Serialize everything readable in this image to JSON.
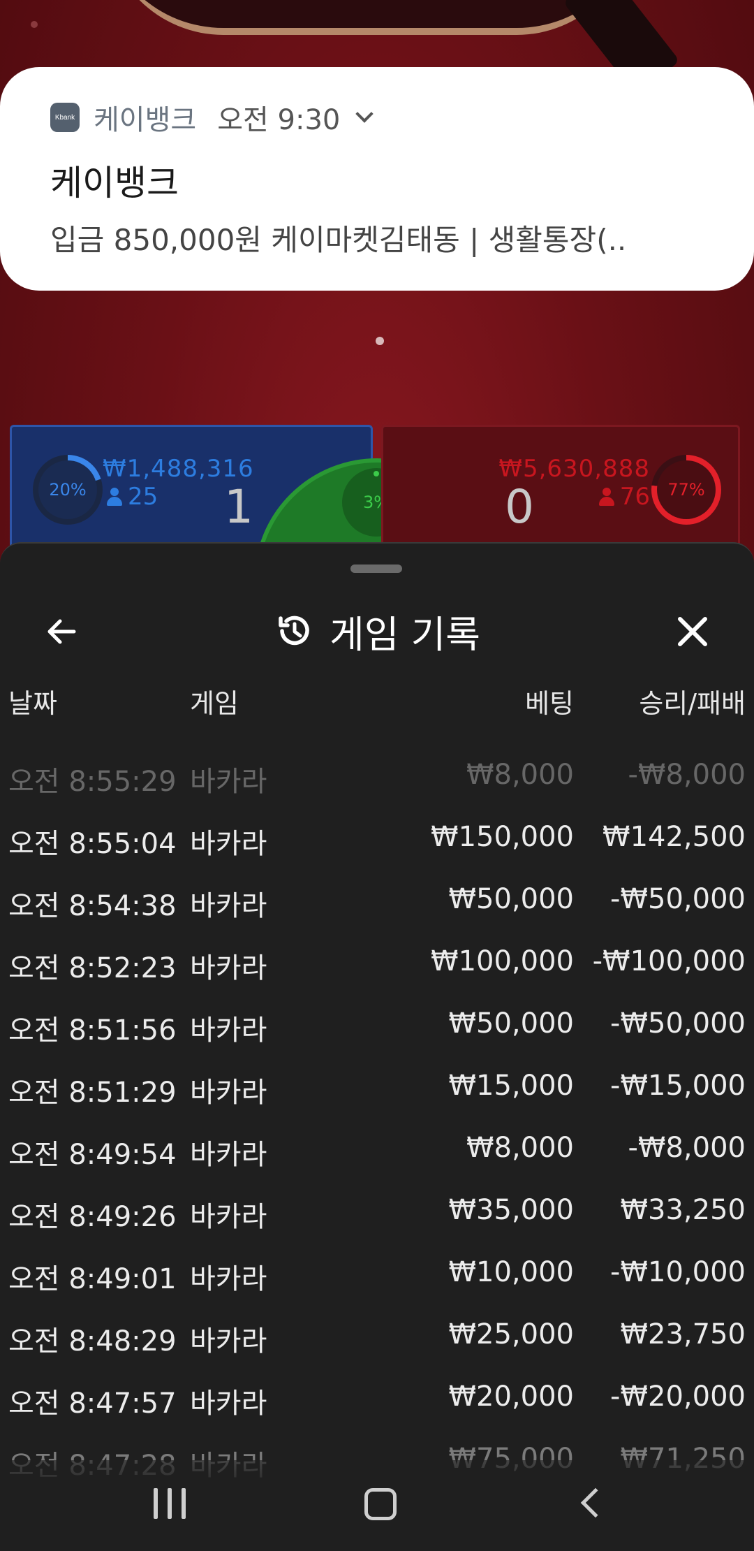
{
  "notification": {
    "app_icon_text": "Kbank",
    "app_name": "케이뱅크",
    "time": "오전 9:30",
    "title": "케이뱅크",
    "body": "입금 850,000원 케이마켓김태동 | 생활통장(.."
  },
  "game": {
    "player": {
      "percent": "20%",
      "percent_value": 0.2,
      "amount": "₩1,488,316",
      "count": "25",
      "score": "1"
    },
    "tie": {
      "percent": "3%"
    },
    "banker": {
      "percent": "77%",
      "percent_value": 0.77,
      "amount": "₩5,630,888",
      "count": "76",
      "score": "0"
    }
  },
  "sheet": {
    "title": "게임 기록",
    "columns": {
      "date": "날짜",
      "game": "게임",
      "bet": "베팅",
      "win_loss": "승리/패배"
    },
    "rows": [
      {
        "date": "오전 8:55:29",
        "game": "바카라",
        "bet": "₩8,000",
        "result": "-₩8,000"
      },
      {
        "date": "오전 8:55:04",
        "game": "바카라",
        "bet": "₩150,000",
        "result": "₩142,500"
      },
      {
        "date": "오전 8:54:38",
        "game": "바카라",
        "bet": "₩50,000",
        "result": "-₩50,000"
      },
      {
        "date": "오전 8:52:23",
        "game": "바카라",
        "bet": "₩100,000",
        "result": "-₩100,000"
      },
      {
        "date": "오전 8:51:56",
        "game": "바카라",
        "bet": "₩50,000",
        "result": "-₩50,000"
      },
      {
        "date": "오전 8:51:29",
        "game": "바카라",
        "bet": "₩15,000",
        "result": "-₩15,000"
      },
      {
        "date": "오전 8:49:54",
        "game": "바카라",
        "bet": "₩8,000",
        "result": "-₩8,000"
      },
      {
        "date": "오전 8:49:26",
        "game": "바카라",
        "bet": "₩35,000",
        "result": "₩33,250"
      },
      {
        "date": "오전 8:49:01",
        "game": "바카라",
        "bet": "₩10,000",
        "result": "-₩10,000"
      },
      {
        "date": "오전 8:48:29",
        "game": "바카라",
        "bet": "₩25,000",
        "result": "₩23,750"
      },
      {
        "date": "오전 8:47:57",
        "game": "바카라",
        "bet": "₩20,000",
        "result": "-₩20,000"
      },
      {
        "date": "오전 8:47:28",
        "game": "바카라",
        "bet": "₩75,000",
        "result": "₩71,250"
      }
    ]
  },
  "colors": {
    "player_blue": "#2d7de0",
    "banker_red": "#c8161f",
    "tie_green": "#3ccc4a",
    "sheet_bg": "#1f1f1f"
  },
  "icons": [
    "back-arrow-icon",
    "history-icon",
    "close-icon",
    "person-icon",
    "recent-apps-icon",
    "home-icon",
    "nav-back-icon",
    "chevron-down-icon"
  ]
}
